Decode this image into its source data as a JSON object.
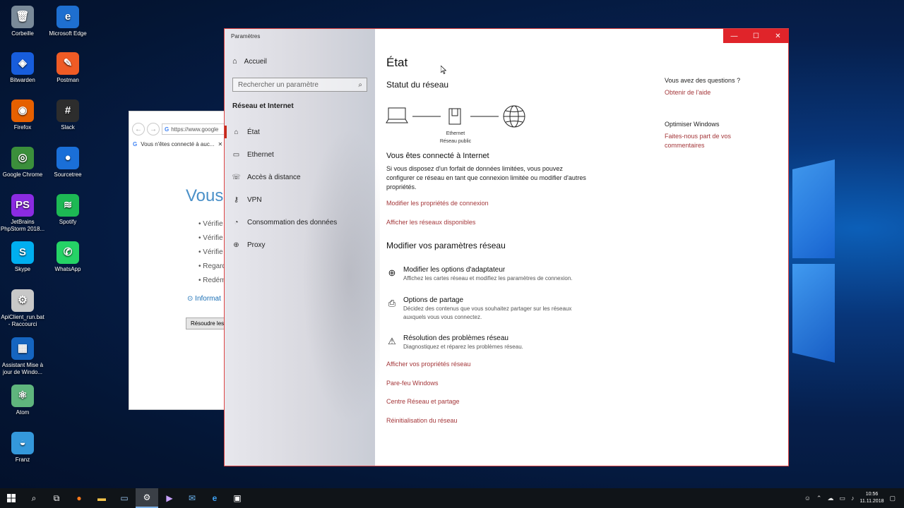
{
  "desktop": {
    "icons": [
      {
        "label": "Corbeille",
        "glyph": "🗑",
        "color": "#7a8a99"
      },
      {
        "label": "Microsoft Edge",
        "glyph": "e",
        "color": "#1e6fd0"
      },
      {
        "label": "Bitwarden",
        "glyph": "◈",
        "color": "#175ddc"
      },
      {
        "label": "Postman",
        "glyph": "✎",
        "color": "#ef5b25"
      },
      {
        "label": "Firefox",
        "glyph": "◉",
        "color": "#e66000"
      },
      {
        "label": "Slack",
        "glyph": "#",
        "color": "#2d2d2d"
      },
      {
        "label": "Google Chrome",
        "glyph": "◎",
        "color": "#3b8f3b"
      },
      {
        "label": "Sourcetree",
        "glyph": "●",
        "color": "#1a6fd8"
      },
      {
        "label": "JetBrains PhpStorm 2018...",
        "glyph": "PS",
        "color": "#8b2be2"
      },
      {
        "label": "Spotify",
        "glyph": "≋",
        "color": "#1db954"
      },
      {
        "label": "Skype",
        "glyph": "S",
        "color": "#00aff0"
      },
      {
        "label": "WhatsApp",
        "glyph": "✆",
        "color": "#25d366"
      },
      {
        "label": "ApiClient_run.bat - Raccourci",
        "glyph": "⚙",
        "color": "#c8c8c8"
      },
      {
        "label": "Assistant Mise à jour de Windo...",
        "glyph": "▦",
        "color": "#1565c0"
      },
      {
        "label": "Atom",
        "glyph": "⚛",
        "color": "#5fb57d"
      },
      {
        "label": "Franz",
        "glyph": "◒",
        "color": "#3498db"
      }
    ]
  },
  "chrome": {
    "url": "https://www.google",
    "tab": "Vous n'êtes connecté à auc...",
    "heading": "Vous",
    "bullets": [
      "Vérifie",
      "Vérifie",
      "Vérifie",
      "Regard",
      "Redém"
    ],
    "info": "Informat",
    "button": "Résoudre les"
  },
  "settings": {
    "app_title": "Paramètres",
    "home": "Accueil",
    "search_placeholder": "Rechercher un paramètre",
    "section": "Réseau et Internet",
    "nav": [
      {
        "label": "État",
        "icon": "home-icon"
      },
      {
        "label": "Ethernet",
        "icon": "monitor-icon"
      },
      {
        "label": "Accès à distance",
        "icon": "dialup-icon"
      },
      {
        "label": "VPN",
        "icon": "vpn-icon"
      },
      {
        "label": "Consommation des données",
        "icon": "data-usage-icon"
      },
      {
        "label": "Proxy",
        "icon": "globe-icon"
      }
    ],
    "page_title": "État",
    "status_title": "Statut du réseau",
    "diagram_label_1": "Ethernet",
    "diagram_label_2": "Réseau public",
    "connected_title": "Vous êtes connecté à Internet",
    "connected_text": "Si vous disposez d'un forfait de données limitées, vous pouvez configurer ce réseau en tant que connexion limitée ou modifier d'autres propriétés.",
    "link_props": "Modifier les propriétés de connexion",
    "link_networks": "Afficher les réseaux disponibles",
    "modify_title": "Modifier vos paramètres réseau",
    "options": [
      {
        "title": "Modifier les options d'adaptateur",
        "desc": "Affichez les cartes réseau et modifiez les paramètres de connexion."
      },
      {
        "title": "Options de partage",
        "desc": "Décidez des contenus que vous souhaitez partager sur les réseaux auxquels vous vous connectez."
      },
      {
        "title": "Résolution des problèmes réseau",
        "desc": "Diagnostiquez et réparez les problèmes réseau."
      }
    ],
    "bottom_links": [
      "Afficher vos propriétés réseau",
      "Pare-feu Windows",
      "Centre Réseau et partage",
      "Réinitialisation du réseau"
    ],
    "questions_title": "Vous avez des questions ?",
    "help_link": "Obtenir de l'aide",
    "improve_title": "Optimiser Windows",
    "feedback_link": "Faites-nous part de vos commentaires"
  },
  "taskbar": {
    "time": "10:56",
    "date": "11.11.2018"
  },
  "colors": {
    "accent_link": "#a4373a",
    "close_button": "#e0242a"
  }
}
